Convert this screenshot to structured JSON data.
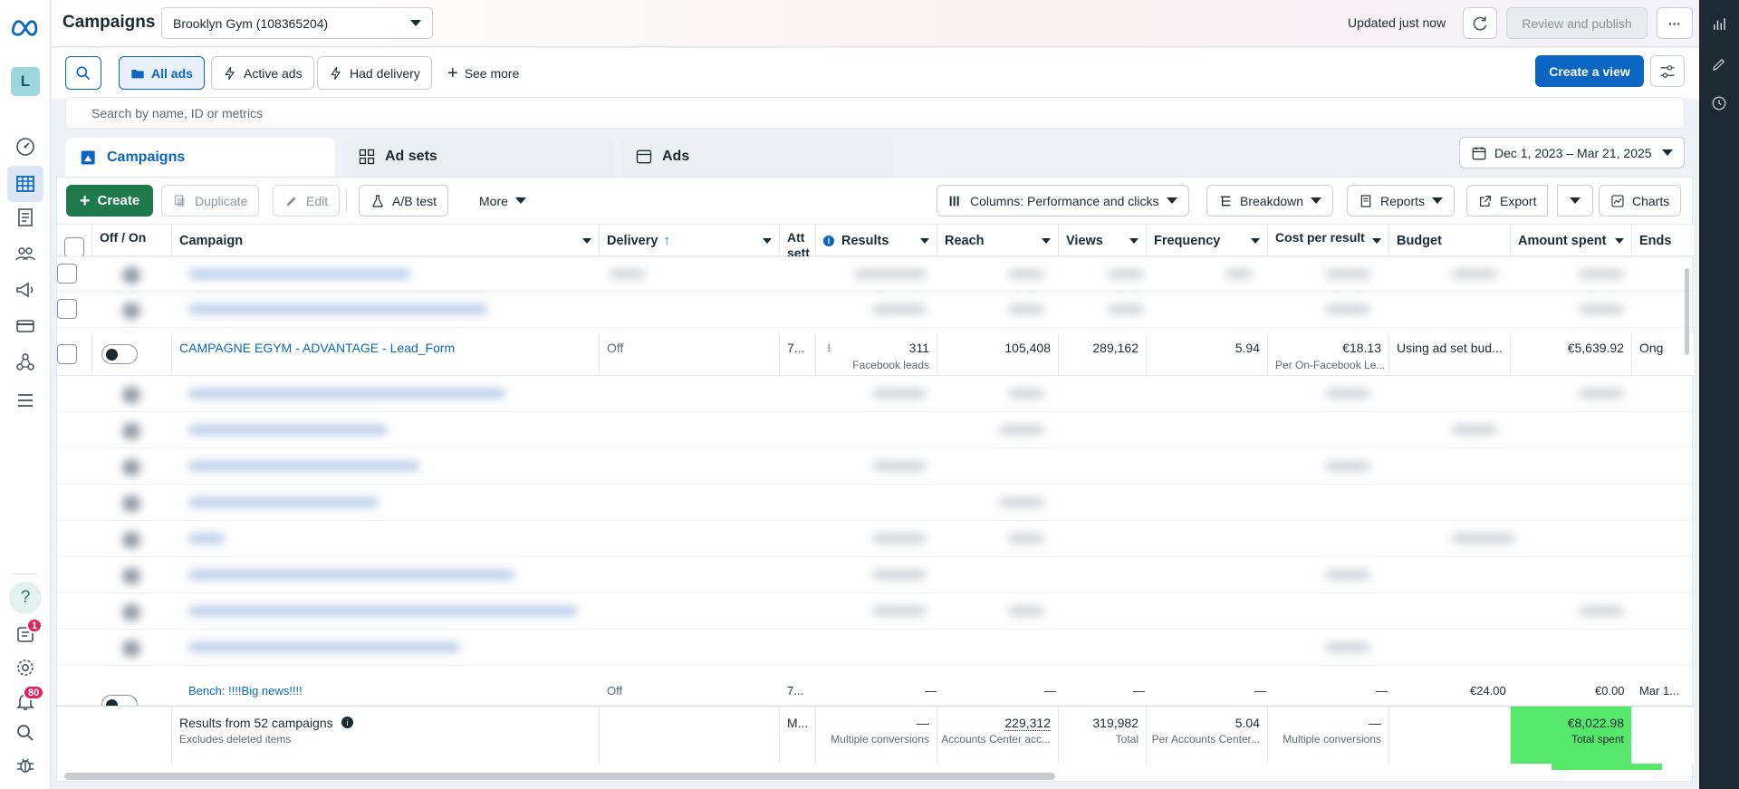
{
  "header": {
    "title": "Campaigns",
    "account": "Brooklyn Gym (108365204)",
    "updated": "Updated just now",
    "review_publish": "Review and publish",
    "more": "···"
  },
  "rail": {
    "avatar_letter": "L",
    "help": "?",
    "notifications_badge": "1",
    "alerts_badge": "80"
  },
  "filters": {
    "all_ads": "All ads",
    "active_ads": "Active ads",
    "had_delivery": "Had delivery",
    "see_more": "See more",
    "create_view": "Create a view"
  },
  "search": {
    "placeholder": "Search by name, ID or metrics"
  },
  "tabs": {
    "campaigns": "Campaigns",
    "ad_sets": "Ad sets",
    "ads": "Ads"
  },
  "date_range": "Dec 1, 2023 – Mar 21, 2025",
  "toolbar": {
    "create": "Create",
    "duplicate": "Duplicate",
    "edit": "Edit",
    "ab_test": "A/B test",
    "more": "More",
    "columns": "Columns: Performance and clicks",
    "breakdown": "Breakdown",
    "reports": "Reports",
    "export": "Export",
    "charts": "Charts"
  },
  "columns": {
    "off_on": "Off / On",
    "campaign": "Campaign",
    "delivery": "Delivery",
    "attribution": "Att sett",
    "results": "Results",
    "reach": "Reach",
    "views": "Views",
    "frequency": "Frequency",
    "cost_per_result": "Cost per result",
    "budget": "Budget",
    "amount_spent": "Amount spent",
    "ends": "Ends"
  },
  "row": {
    "campaign": "CAMPAGNE EGYM - ADVANTAGE - Lead_Form",
    "delivery": "Off",
    "attribution": "7...",
    "results": "311",
    "results_sub": "Facebook leads",
    "reach": "105,408",
    "views": "289,162",
    "frequency": "5.94",
    "cost_per_result": "€18.13",
    "cost_per_result_sub": "Per On-Facebook Le...",
    "budget": "Using ad set bud...",
    "amount_spent": "€5,639.92",
    "ends": "Ong"
  },
  "partial_row": {
    "campaign": "Bench:  !!!!Big news!!!!",
    "delivery": "Off",
    "attribution": "7...",
    "results": "—",
    "reach": "—",
    "views": "—",
    "frequency": "—",
    "cost_per_result": "—",
    "budget": "€24.00",
    "amount_spent": "€0.00",
    "ends": "Mar 1..."
  },
  "summary": {
    "label": "Results from 52 campaigns",
    "sub": "Excludes deleted items",
    "attribution": "M...",
    "results": "—",
    "results_sub": "Multiple conversions",
    "reach": "229,312",
    "reach_sub": "Accounts Center acc...",
    "views": "319,982",
    "views_sub": "Total",
    "frequency": "5.04",
    "frequency_sub": "Per Accounts Center...",
    "cost_per_result": "—",
    "cost_per_result_sub": "Multiple conversions",
    "amount_spent": "€8,022.98",
    "amount_spent_sub": "Total spent"
  },
  "colors": {
    "accent": "#0a66c2",
    "create_green": "#1e7a4a",
    "highlight": "#55e86b"
  }
}
